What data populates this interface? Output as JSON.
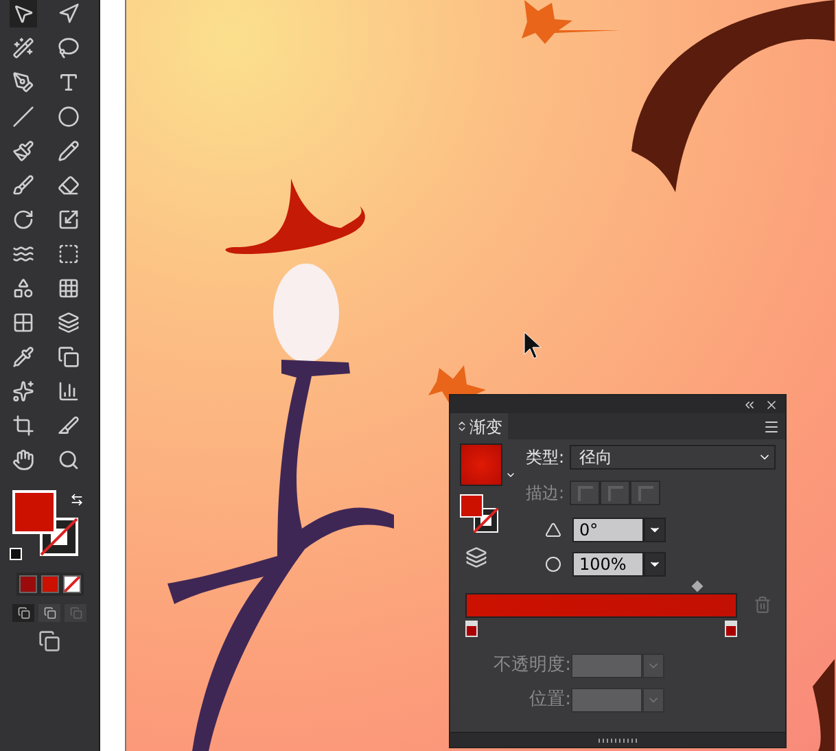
{
  "panel": {
    "title": "渐变",
    "type_field": {
      "label": "类型:",
      "value": "径向"
    },
    "stroke": {
      "label": "描边:",
      "disabled": true
    },
    "angle": {
      "value": "0°"
    },
    "aspect": {
      "value": "100%"
    },
    "opacity": {
      "label": "不透明度:",
      "disabled": true
    },
    "location": {
      "label": "位置:",
      "disabled": true
    }
  }
}
